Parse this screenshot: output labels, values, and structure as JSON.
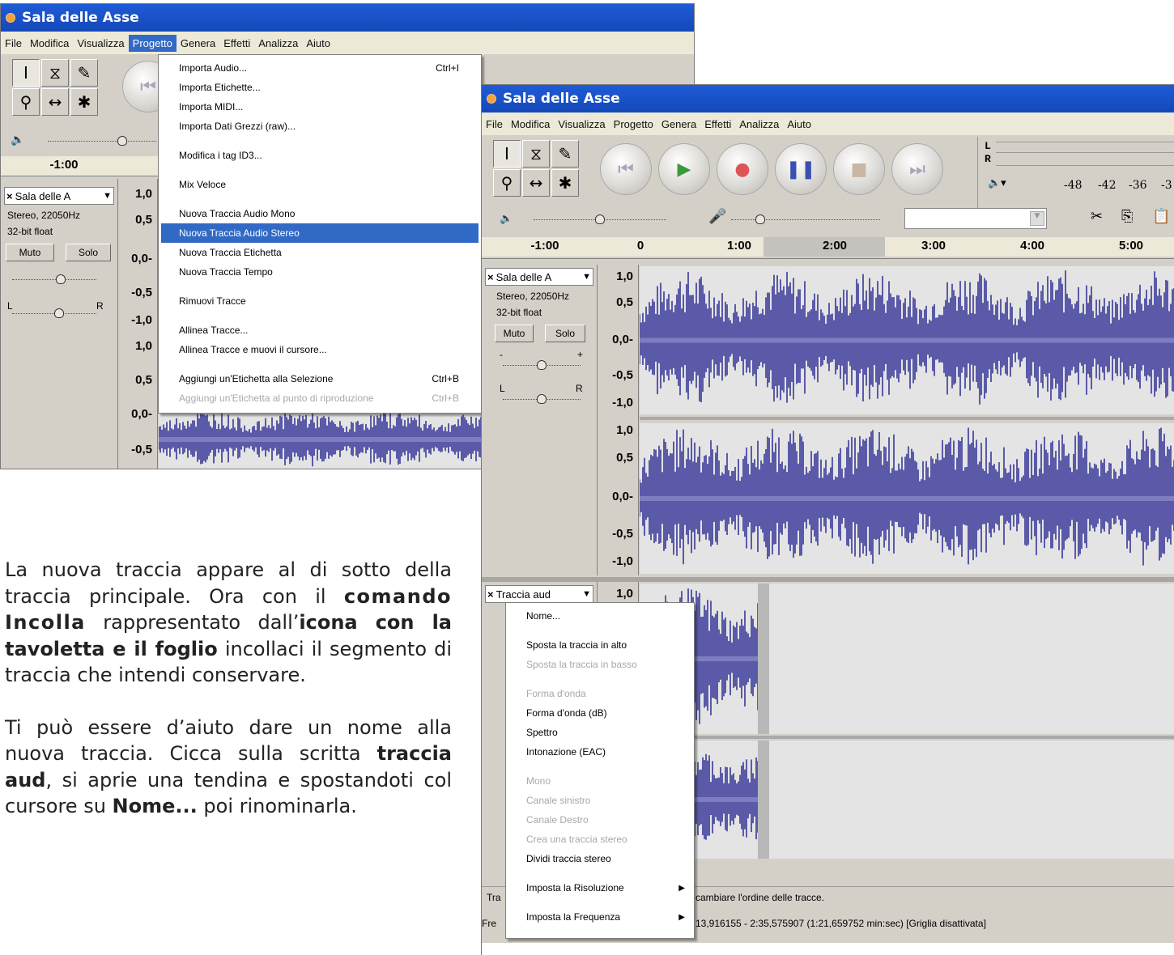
{
  "window_title": "Sala delle Asse",
  "menus": [
    "File",
    "Modifica",
    "Visualizza",
    "Progetto",
    "Genera",
    "Effetti",
    "Analizza",
    "Aiuto"
  ],
  "active_menu": "Progetto",
  "progetto_menu": {
    "groups": [
      [
        {
          "label": "Importa Audio...",
          "shortcut": "Ctrl+I"
        },
        {
          "label": "Importa Etichette..."
        },
        {
          "label": "Importa MIDI..."
        },
        {
          "label": "Importa Dati Grezzi (raw)..."
        }
      ],
      [
        {
          "label": "Modifica i tag ID3..."
        }
      ],
      [
        {
          "label": "Mix Veloce"
        }
      ],
      [
        {
          "label": "Nuova Traccia Audio Mono"
        },
        {
          "label": "Nuova Traccia Audio Stereo",
          "highlighted": true
        },
        {
          "label": "Nuova Traccia Etichetta"
        },
        {
          "label": "Nuova Traccia Tempo"
        }
      ],
      [
        {
          "label": "Rimuovi Tracce"
        }
      ],
      [
        {
          "label": "Allinea Tracce..."
        },
        {
          "label": "Allinea Tracce e muovi il cursore..."
        }
      ],
      [
        {
          "label": "Aggiungi un'Etichetta alla Selezione",
          "shortcut": "Ctrl+B"
        },
        {
          "label": "Aggiungi un'Etichetta al punto di riproduzione",
          "shortcut": "Ctrl+B",
          "disabled": true
        }
      ]
    ]
  },
  "track_menu": {
    "items": [
      {
        "label": "Nome..."
      },
      {
        "sep": true
      },
      {
        "label": "Sposta la traccia in alto"
      },
      {
        "label": "Sposta la traccia in basso",
        "disabled": true
      },
      {
        "sep": true
      },
      {
        "label": "Forma d'onda",
        "disabled": true
      },
      {
        "label": "Forma d'onda (dB)"
      },
      {
        "label": "Spettro"
      },
      {
        "label": "Intonazione (EAC)"
      },
      {
        "sep": true
      },
      {
        "label": "Mono",
        "disabled": true
      },
      {
        "label": "Canale sinistro",
        "disabled": true
      },
      {
        "label": "Canale Destro",
        "disabled": true
      },
      {
        "label": "Crea una traccia stereo",
        "disabled": true
      },
      {
        "label": "Dividi traccia stereo"
      },
      {
        "sep": true
      },
      {
        "label": "Imposta la Risoluzione",
        "submenu": true
      },
      {
        "sep": true
      },
      {
        "label": "Imposta la Frequenza",
        "submenu": true
      }
    ]
  },
  "tracks": {
    "main": {
      "name": "Sala delle A",
      "format": "Stereo, 22050Hz",
      "bits": "32-bit float",
      "mute": "Muto",
      "solo": "Solo",
      "gain_left": "-",
      "gain_right": "+",
      "pan_left": "L",
      "pan_right": "R"
    },
    "second": {
      "name": "Traccia aud"
    }
  },
  "scale_labels": [
    "1,0",
    "0,5",
    "0,0-",
    "-0,5",
    "-1,0"
  ],
  "front_ruler": [
    "-1:00",
    "0",
    "1:00",
    "2:00",
    "3:00",
    "4:00",
    "5:00"
  ],
  "back_ruler": [
    "-1:00"
  ],
  "meter": {
    "left": "L",
    "right": "R",
    "ticks": [
      "-48",
      "-42",
      "-36",
      "-3"
    ]
  },
  "status": {
    "line1_prefix": "Tra",
    "line1": "cambiare l'ordine delle tracce.",
    "line2_prefix": "Fre",
    "line2": "13,916155 - 2:35,575907 (1:21,659752 min:sec)  [Griglia disattivata]"
  },
  "article": {
    "p1": [
      "La nuova traccia appare al di sotto della traccia principale. Ora con il ",
      "comando Incolla",
      " rappresentato dall’",
      "icona con la tavoletta e il foglio",
      " incollaci il segmento di traccia che intendi conservare."
    ],
    "p2": [
      "Ti può essere d’aiuto dare un nome alla nuova traccia. Cicca sulla scritta ",
      "traccia aud",
      ", si aprie una tendina e spostandoti col cursore su ",
      "Nome...",
      " poi rinominarla."
    ]
  },
  "colors": {
    "title": "#1a50c8",
    "wave": "#5a5aa8",
    "highlight": "#316ac5"
  }
}
